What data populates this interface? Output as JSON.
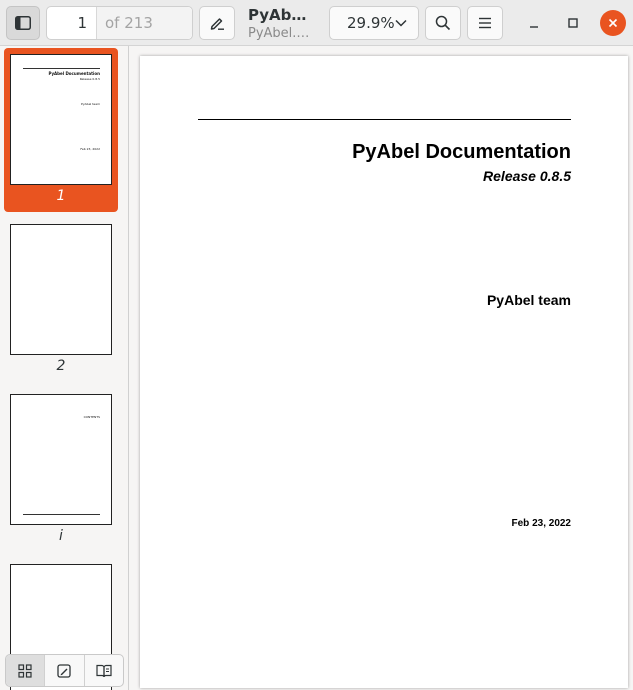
{
  "header": {
    "current_page": "1",
    "page_total": "of 213",
    "doc_title": "PyAb…",
    "doc_subtitle": "PyAbel.…",
    "zoom": "29.9%"
  },
  "sidebar": {
    "thumbnails": [
      {
        "label": "1",
        "selected": true,
        "lines": [
          "PyAbel Documentation",
          "Release 0.8.5",
          "PyAbel team",
          "Feb 23, 2022"
        ]
      },
      {
        "label": "2",
        "selected": false
      },
      {
        "label": "i",
        "selected": false,
        "lines": [
          "CONTENTS"
        ]
      },
      {
        "label": "",
        "selected": false
      }
    ]
  },
  "document": {
    "title": "PyAbel Documentation",
    "release": "Release 0.8.5",
    "author": "PyAbel team",
    "date": "Feb 23, 2022"
  },
  "colors": {
    "accent": "#e95420",
    "headerbar": "#ebebeb",
    "background": "#f6f5f4"
  },
  "icons": {
    "sidebar_toggle": "sidebar-toggle-icon",
    "annotate": "pencil-icon",
    "zoom_dropdown": "chevron-down-icon",
    "search": "search-icon",
    "menu": "hamburger-menu-icon",
    "minimize": "minimize-icon",
    "maximize": "maximize-icon",
    "close": "close-icon",
    "thumbnails_view": "grid-icon",
    "annotations_view": "annotations-icon",
    "bookmarks_view": "bookmarks-icon"
  }
}
